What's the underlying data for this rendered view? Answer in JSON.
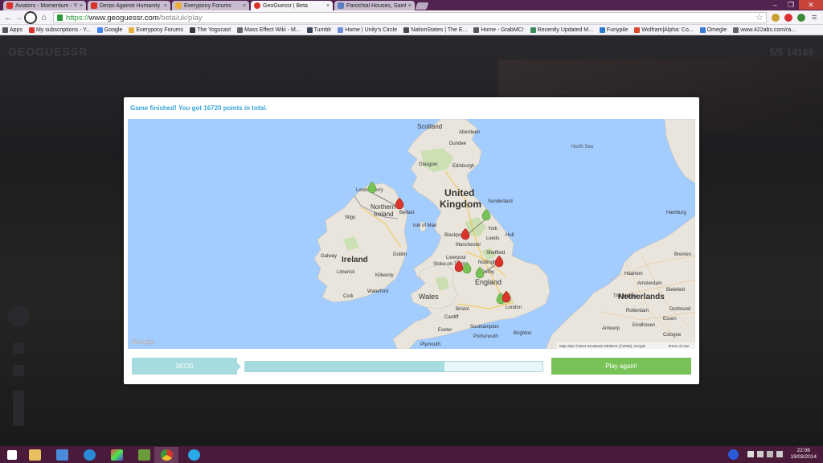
{
  "browser": {
    "tabs": [
      {
        "title": "Aviators - Momentum - Y",
        "favicon_color": "#d9332b"
      },
      {
        "title": "Derps Against Humanity",
        "favicon_color": "#d9332b"
      },
      {
        "title": "Everypony Forums",
        "favicon_color": "#e8b03a"
      },
      {
        "title": "GeoGuessr | Beta",
        "favicon_color": "#d9332b",
        "active": true
      },
      {
        "title": "Parochial Houses, Saintfie",
        "favicon_color": "#5d7dc2"
      }
    ],
    "close_glyph": "×",
    "url_scheme": "https://",
    "url_host": "www.geoguessr.com",
    "url_path": "/beta/uk/play",
    "bookmarks": [
      {
        "label": "Apps",
        "color": "#555555"
      },
      {
        "label": "My subscriptions - Y...",
        "color": "#d9332b"
      },
      {
        "label": "Google",
        "color": "#4285f4"
      },
      {
        "label": "Everypony Forums",
        "color": "#e8b03a"
      },
      {
        "label": "The Yogscast",
        "color": "#3a3a3a"
      },
      {
        "label": "Mass Effect Wiki - M...",
        "color": "#666666"
      },
      {
        "label": "Tumblr",
        "color": "#35465c"
      },
      {
        "label": "Home | Unity's Circle",
        "color": "#6b8fd8"
      },
      {
        "label": "NationStates | The E...",
        "color": "#4a4a4a"
      },
      {
        "label": "Home - GrabMC!",
        "color": "#5a5a5a"
      },
      {
        "label": "Recently Updated M...",
        "color": "#3a8a5a"
      },
      {
        "label": "Funypile",
        "color": "#2a7ad0"
      },
      {
        "label": "Wolfram|Alpha: Co...",
        "color": "#d84a2a"
      },
      {
        "label": "Omegle",
        "color": "#3a7ad8"
      },
      {
        "label": "www.422abs.com/ra...",
        "color": "#666666"
      }
    ]
  },
  "game": {
    "logo": "GEOGUESSR",
    "round": "5/5",
    "score_display": "14169",
    "result_message": "Game finished! You got 16720 points in total.",
    "final_score": "16720",
    "progress_fraction": 0.67,
    "play_again_label": "Play again!"
  },
  "map": {
    "labels": {
      "scotland": "Scotland",
      "united": "United",
      "kingdom": "Kingdom",
      "northern": "Northern",
      "ireland_ni": "Ireland",
      "ireland": "Ireland",
      "isle_of_man": "Isle of Man",
      "wales": "Wales",
      "england": "England",
      "north_sea": "North Sea",
      "netherlands": "Netherlands",
      "glasgow": "Glasgow",
      "edinburgh": "Edinburgh",
      "dundee": "Dundee",
      "aberdeen": "Aberdeen",
      "sunderland": "Sunderland",
      "belfast": "Belfast",
      "dublin": "Dublin",
      "manchester": "Manchester",
      "liverpool": "Liverpool",
      "leeds": "Leeds",
      "sheffield": "Sheffield",
      "york": "York",
      "hull": "Hull",
      "blackpool": "Blackpool",
      "nottingham": "Nottingham",
      "derby": "Derby",
      "stoke": "Stoke-on-Trent",
      "london": "London",
      "bristol": "Bristol",
      "cardiff": "Cardiff",
      "southampton": "Southampton",
      "portsmouth": "Portsmouth",
      "brighton": "Brighton",
      "plymouth": "Plymouth",
      "exeter": "Exeter",
      "galway": "Galway",
      "limerick": "Limerick",
      "cork": "Cork",
      "waterford": "Waterford",
      "kilkenny": "Kilkenny",
      "sligo": "Sligo",
      "derry": "Londonderry",
      "amsterdam": "Amsterdam",
      "rotterdam": "Rotterdam",
      "the_hague": "The Hague",
      "haarlem": "Haarlem",
      "antwerp": "Antwerp",
      "eindhoven": "Eindhoven",
      "essen": "Essen",
      "cologne": "Cologne",
      "bremen": "Bremen",
      "hamburg": "Hamburg",
      "bielefeld": "Bielefeld",
      "dortmund": "Dortmund"
    },
    "attribution": "Map data ©2014 GeoBasis-DE/BKG (©2009), Google",
    "terms": "Terms of Use",
    "google_logo": "Google"
  },
  "taskbar": {
    "time": "22:08",
    "date": "19/03/2014"
  }
}
